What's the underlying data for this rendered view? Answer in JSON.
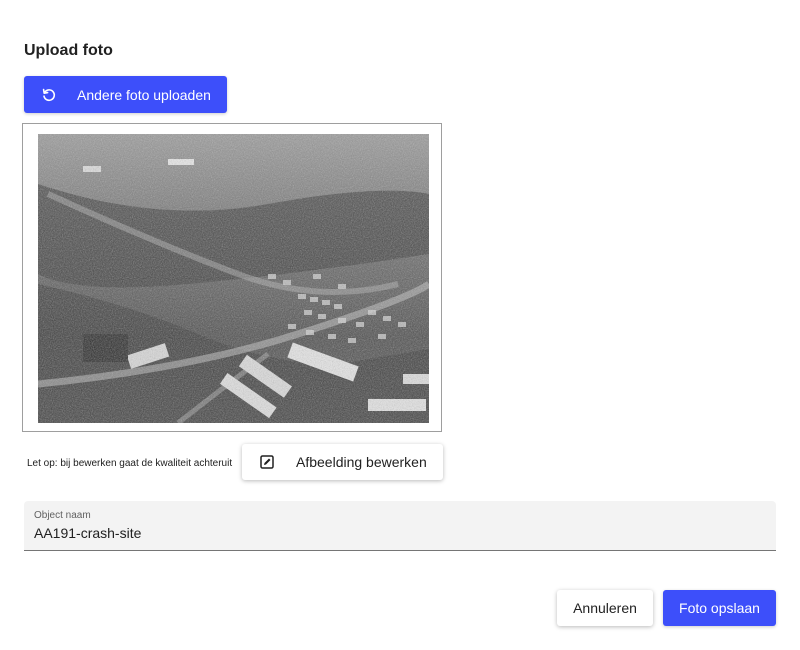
{
  "dialog": {
    "title": "Upload foto",
    "upload_button_label": "Andere foto uploaden",
    "upload_button_icon": "undo-icon",
    "edit_note": "Let op: bij bewerken gaat de kwaliteit achteruit",
    "edit_button_label": "Afbeelding bewerken",
    "edit_button_icon": "edit-icon",
    "object_name": {
      "label": "Object naam",
      "value": "AA191-crash-site"
    },
    "cancel_label": "Annuleren",
    "save_label": "Foto opslaan"
  },
  "colors": {
    "primary": "#3d4ffa",
    "field_bg": "#f3f3f3"
  }
}
